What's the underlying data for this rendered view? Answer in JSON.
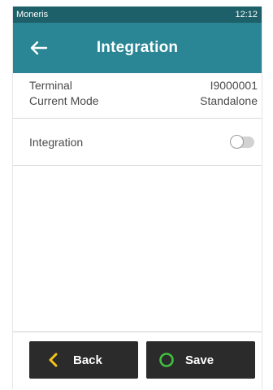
{
  "status_bar": {
    "carrier": "Moneris",
    "time": "12:12"
  },
  "app_bar": {
    "title": "Integration",
    "back_icon": "arrow-left-icon"
  },
  "info": {
    "terminal_label": "Terminal",
    "terminal_value": "I9000001",
    "mode_label": "Current Mode",
    "mode_value": "Standalone"
  },
  "integration_setting": {
    "label": "Integration",
    "enabled": false
  },
  "buttons": {
    "back_label": "Back",
    "back_icon": "chevron-left-icon",
    "save_label": "Save",
    "save_icon": "circle-icon"
  },
  "colors": {
    "status_bar": "#1d6069",
    "app_bar": "#2a8594",
    "button_bg": "#2b2b2b",
    "back_icon": "#f5c518",
    "save_icon": "#3fbf3f"
  }
}
